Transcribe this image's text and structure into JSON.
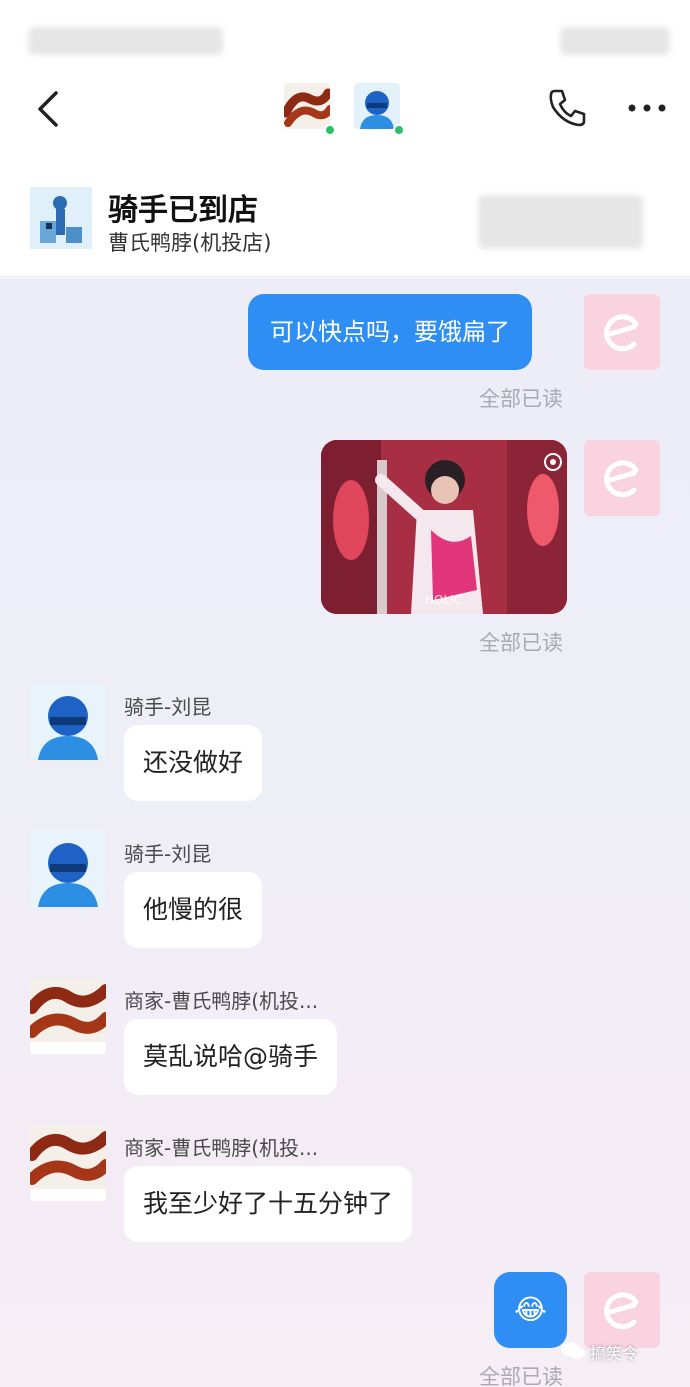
{
  "header": {
    "title": "骑手已到店",
    "subtitle": "曹氏鸭脖(机投店)"
  },
  "messages": {
    "m1": {
      "text": "可以快点吗，要饿扁了",
      "status": "全部已读"
    },
    "m2": {
      "status": "全部已读",
      "image_caption": "HOLIC"
    },
    "m3": {
      "sender": "骑手-刘昆",
      "text": "还没做好"
    },
    "m4": {
      "sender": "骑手-刘昆",
      "text": "他慢的很"
    },
    "m5": {
      "sender": "商家-曹氏鸭脖(机投...",
      "text": "莫乱说哈@骑手"
    },
    "m6": {
      "sender": "商家-曹氏鸭脖(机投...",
      "text": "我至少好了十五分钟了"
    },
    "m7": {
      "emoji": "😂",
      "status": "全部已读"
    }
  },
  "watermark": {
    "text": "搞笑令"
  },
  "colors": {
    "accent": "#2f8ef3",
    "online": "#2bbf6a",
    "self_avatar": "#f9d3df",
    "chat_bg": "#ecedf7"
  },
  "icons": [
    "back-icon",
    "phone-icon",
    "more-icon",
    "camera-icon",
    "wechat-icon"
  ]
}
